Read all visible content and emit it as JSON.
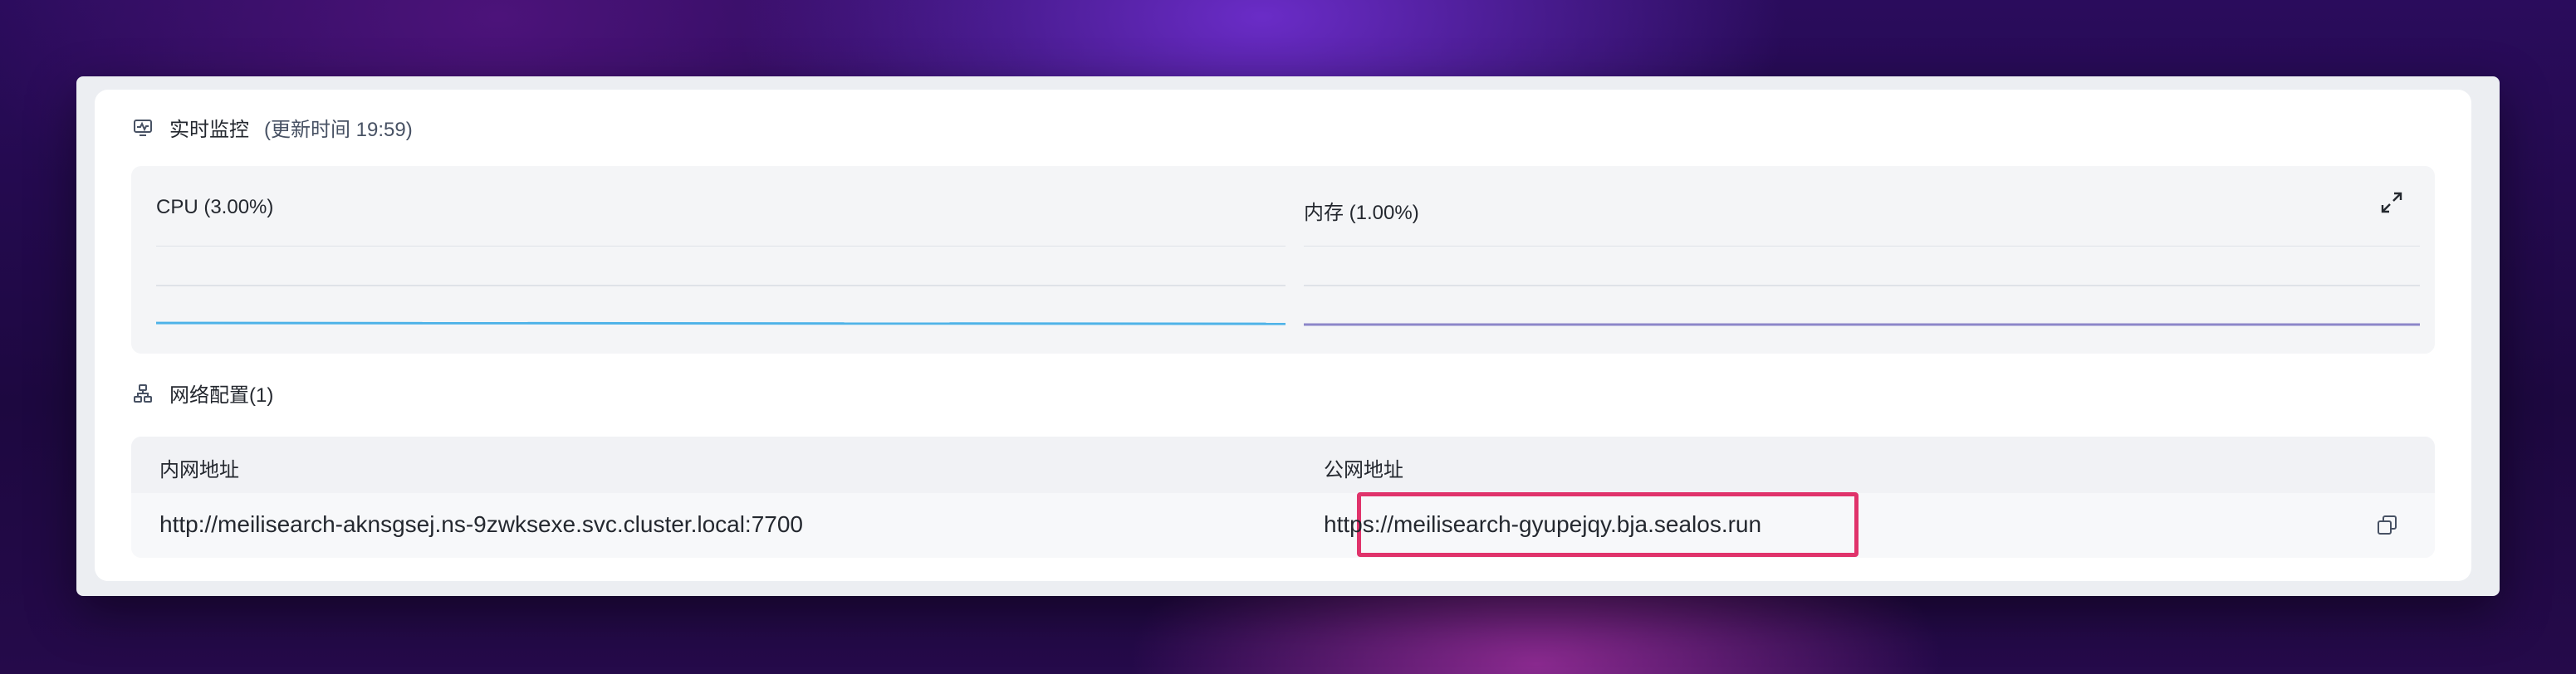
{
  "monitor": {
    "title": "实时监控",
    "update_label": "(更新时间  19:59)",
    "cpu_label": "CPU  (3.00%)",
    "memory_label": "内存  (1.00%)",
    "cpu_value": 3.0,
    "memory_value": 1.0,
    "cpu_color": "#4fb3e8",
    "memory_color": "#8c86c9"
  },
  "network": {
    "title": "网络配置(1)",
    "columns": [
      "内网地址",
      "公网地址"
    ],
    "rows": [
      {
        "internal": "http://meilisearch-aknsgsej.ns-9zwksexe.svc.cluster.local:7700",
        "public": "https://meilisearch-gyupejqy.bja.sealos.run"
      }
    ],
    "highlight_color": "#e0336b"
  }
}
